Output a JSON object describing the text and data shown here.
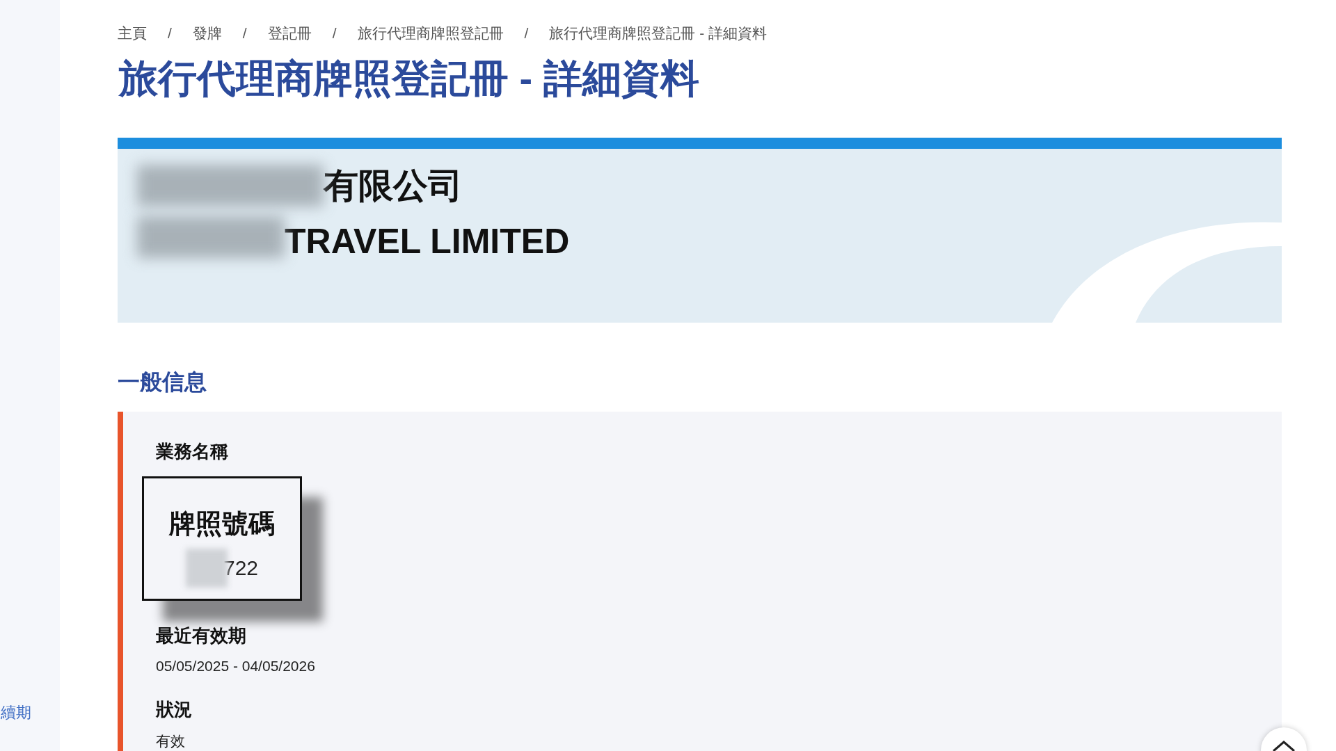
{
  "sidebar": {
    "items": [
      {
        "label": "續期"
      }
    ]
  },
  "breadcrumb": [
    {
      "label": "主頁"
    },
    {
      "separator": "/",
      "label": "發牌"
    },
    {
      "separator": "/",
      "label": "登記冊"
    },
    {
      "separator": "/",
      "label": "旅行代理商牌照登記冊"
    },
    {
      "separator": "/",
      "label": "旅行代理商牌照登記冊 - 詳細資料"
    }
  ],
  "page_title": "旅行代理商牌照登記冊 - 詳細資料",
  "company": {
    "name_zh": "有限公司",
    "name_en": "TRAVEL LIMITED"
  },
  "section_title": "一般信息",
  "fields": [
    {
      "label": "業務名稱"
    },
    {
      "label": "最近有效期",
      "value": "05/05/2025 - 04/05/2026"
    },
    {
      "label": "狀況",
      "value": "有效"
    }
  ],
  "callout": {
    "label": "牌照號碼",
    "value": "722"
  }
}
